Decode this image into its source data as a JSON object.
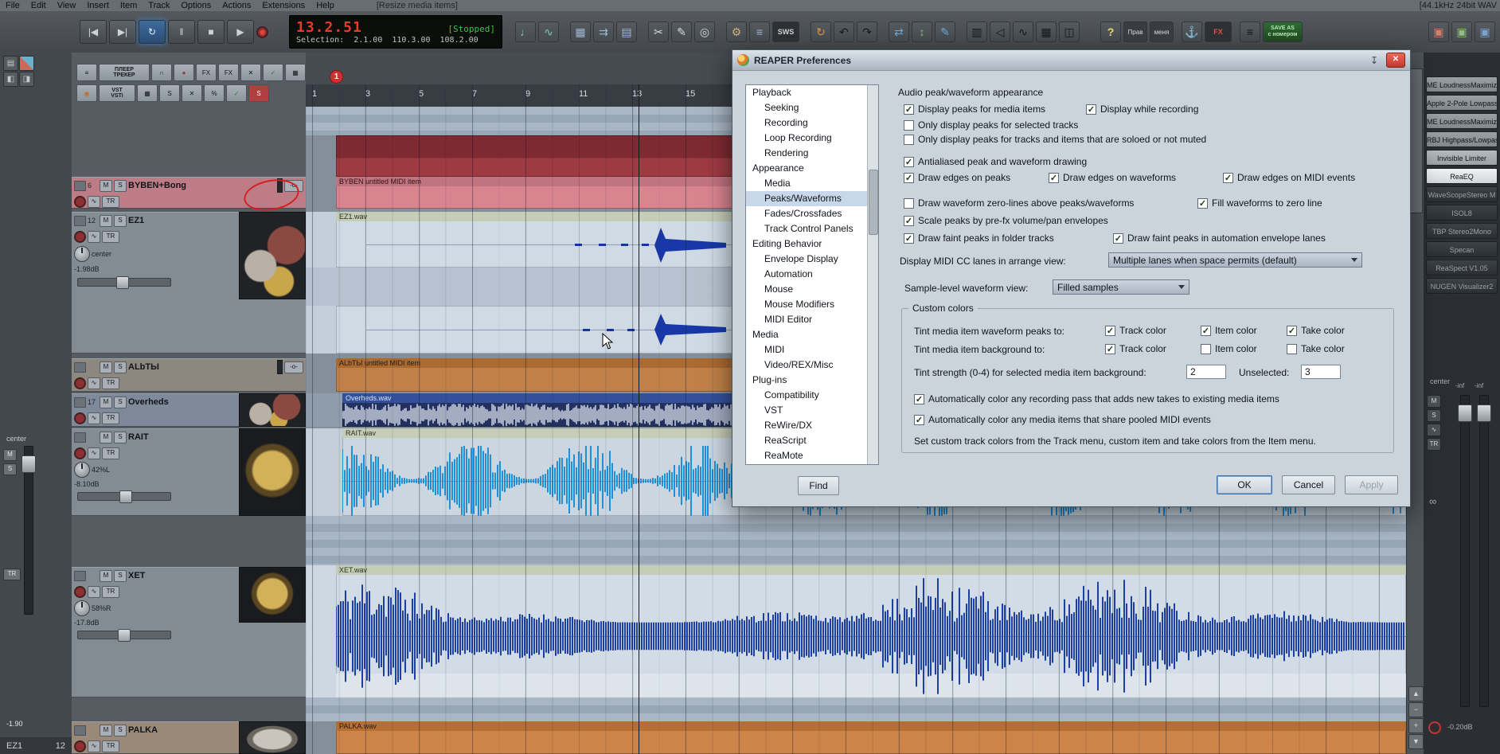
{
  "colors": {
    "time_red": "#e8392b",
    "stopped_green": "#3fc24d",
    "record_red": "#e04438",
    "repeat_active": "#3b82c4",
    "selected_item_navy": "#22315f",
    "wave_blue": "#1d3fa2",
    "rait_blue": "#1f8fd6",
    "byben_pink": "#d8858f",
    "albty_brown": "#bf7a3e",
    "palka_orange": "#cd8448"
  },
  "menu": {
    "items": [
      "File",
      "Edit",
      "View",
      "Insert",
      "Item",
      "Track",
      "Options",
      "Actions",
      "Extensions",
      "Help"
    ],
    "hint": "[Resize media items]",
    "right_status": "[44.1kHz 24bit WAV"
  },
  "transport": {
    "buttons": [
      {
        "name": "go-to-start",
        "g": "|◀"
      },
      {
        "name": "go-to-end",
        "g": "▶|"
      },
      {
        "name": "repeat",
        "g": "↻"
      },
      {
        "name": "pause",
        "g": "‖"
      },
      {
        "name": "stop",
        "g": "■"
      },
      {
        "name": "play",
        "g": "▶"
      },
      {
        "name": "record",
        "g": "●"
      }
    ],
    "time": "13.2.51",
    "state": "[Stopped]",
    "selection_label": "Selection:",
    "sel_start": "2.1.00",
    "sel_end": "110.3.00",
    "sel_length": "108.2.00"
  },
  "toolbar": {
    "icons": [
      {
        "name": "metronome-icon",
        "g": "♩",
        "c": "#7cc8b6"
      },
      {
        "name": "master-env-icon",
        "g": "∿",
        "c": "#7cc8b6"
      },
      {
        "name": "grid-icon",
        "g": "▦",
        "c": "#9db7d2"
      },
      {
        "name": "routing-matrix-icon",
        "g": "⇉",
        "c": "#9db7d2"
      },
      {
        "name": "io-matrix-icon",
        "g": "▤",
        "c": "#9db7d2"
      },
      {
        "name": "scissors-icon",
        "g": "✂",
        "c": "#d6dade"
      },
      {
        "name": "pencil-icon",
        "g": "✎",
        "c": "#d6dade"
      },
      {
        "name": "zoom-icon",
        "g": "◎",
        "c": "#d6dade"
      },
      {
        "name": "wrench-icon",
        "g": "⚙",
        "c": "#cdb27a"
      },
      {
        "name": "mixer-icon",
        "g": "≡",
        "c": "#9db7d2"
      },
      {
        "name": "sws-badge",
        "g": "SWS",
        "c": "#cfd4d8"
      },
      {
        "name": "loop-icon",
        "g": "↻",
        "c": "#e2953f"
      },
      {
        "name": "undo-icon",
        "g": "↶",
        "c": "#c3c8cd"
      },
      {
        "name": "redo-icon",
        "g": "↷",
        "c": "#c3c8cd"
      },
      {
        "name": "sync-icon",
        "g": "⇄",
        "c": "#6fa8dc"
      },
      {
        "name": "nudge-icon",
        "g": "↕",
        "c": "#79c879"
      },
      {
        "name": "draw-icon",
        "g": "✎",
        "c": "#6fa8dc"
      },
      {
        "name": "grid-2-icon",
        "g": "▥",
        "c": "#c3c8cd"
      },
      {
        "name": "speaker-icon",
        "g": "◁",
        "c": "#c3c8cd"
      },
      {
        "name": "envelope-icon",
        "g": "∿",
        "c": "#c3c8cd"
      },
      {
        "name": "table-icon",
        "g": "▦",
        "c": "#c3c8cd"
      },
      {
        "name": "panels-icon",
        "g": "◫",
        "c": "#c3c8cd"
      },
      {
        "name": "help-badge",
        "g": "?",
        "c": "#ead973"
      },
      {
        "name": "prav-button",
        "g": "Прав",
        "c": "#d8dce0"
      },
      {
        "name": "menya-button",
        "g": "меня",
        "c": "#d8dce0"
      },
      {
        "name": "anchor-icon",
        "g": "⚓",
        "c": "#c3c8cd"
      },
      {
        "name": "fx-badge",
        "g": "FX",
        "c": "#e05548"
      },
      {
        "name": "list-icon",
        "g": "≡",
        "c": "#c3c8cd"
      },
      {
        "name": "save-as-badge",
        "g": "SAVE AS\nс номером",
        "c": "#b9e8b2"
      },
      {
        "name": "folder-red-icon",
        "g": "▣",
        "c": "#d77d6a"
      },
      {
        "name": "folder-green-icon",
        "g": "▣",
        "c": "#8fbf7a"
      },
      {
        "name": "folder-blue-icon",
        "g": "▣",
        "c": "#7aa4cf"
      }
    ]
  },
  "mini": {
    "row1": [
      {
        "g": "≡"
      },
      {
        "g": "ПЛЕЕР\nТРЕКЕР"
      },
      {
        "g": "∩"
      },
      {
        "g": "●"
      },
      {
        "g": "FX"
      },
      {
        "g": "FX"
      },
      {
        "g": "✕"
      },
      {
        "g": "✓"
      },
      {
        "g": "▦"
      },
      {
        "g": "↔"
      }
    ],
    "row2": [
      {
        "g": "◉"
      },
      {
        "g": "VST\nVSTi"
      },
      {
        "g": "▦"
      },
      {
        "g": "S"
      },
      {
        "g": "✕"
      },
      {
        "g": "%"
      },
      {
        "g": "✓"
      },
      {
        "g": "S"
      }
    ]
  },
  "ui": {
    "m": "M",
    "s": "S",
    "tr": "TR",
    "io": "-o-",
    "env": "∿",
    "up": "▲",
    "down": "▼",
    "plus": "+",
    "minus": "−",
    "inf": "∞",
    "close": "✕",
    "pin": "↧"
  },
  "tracks": [
    {
      "num": "6",
      "name": "BYBEN+Bong",
      "pan": "",
      "vol": ""
    },
    {
      "num": "12",
      "name": "EZ1",
      "pan": "center",
      "vol": "-1.98dB"
    },
    {
      "num": "",
      "name": "ALbTЫ",
      "pan": "",
      "vol": ""
    },
    {
      "num": "17",
      "name": "Overheds",
      "pan": "",
      "vol": ""
    },
    {
      "num": "",
      "name": "RAIT",
      "pan": "42%L",
      "vol": "-8.10dB"
    },
    {
      "num": "",
      "name": "XET",
      "pan": "58%R",
      "vol": "-17.8dB"
    },
    {
      "num": "",
      "name": "PALKA",
      "pan": "",
      "vol": ""
    }
  ],
  "ruler": {
    "marks": [
      "1",
      "3",
      "5",
      "7",
      "9",
      "11",
      "13",
      "15"
    ],
    "marker1": "1"
  },
  "items": {
    "byben": "BYBEN untitled MIDI item",
    "ez1": "EZ1.wav",
    "albty": "ALbTЫ untitled MIDI item",
    "overheds": "Overheds.wav",
    "rait": "RAIT.wav",
    "xet": "XET.wav",
    "palka": "PALKA.wav"
  },
  "fx_panel": {
    "items": [
      {
        "label": "ME LoudnessMaximizer",
        "variant": "gray"
      },
      {
        "label": "Apple 2-Pole Lowpass",
        "variant": "gray"
      },
      {
        "label": "ME LoudnessMaximizer",
        "variant": "gray"
      },
      {
        "label": "RBJ Highpass/Lowpass",
        "variant": "gray"
      },
      {
        "label": "Invisible Limiter",
        "variant": "light"
      },
      {
        "label": "ReaEQ",
        "variant": "selected"
      },
      {
        "label": "WaveScopeStereo M",
        "variant": "dark"
      },
      {
        "label": "ISOL8",
        "variant": "dark"
      },
      {
        "label": "TBP Stereo2Mono",
        "variant": "dark"
      },
      {
        "label": "Specan",
        "variant": "dark"
      },
      {
        "label": "ReaSpect V1.05",
        "variant": "dark"
      },
      {
        "label": "NUGEN Visualizer2",
        "variant": "dark"
      }
    ]
  },
  "right_mixer": {
    "pan": "center",
    "fader1": "-inf",
    "fader2": "-inf",
    "readout": "-0.20dB"
  },
  "left_strip": {
    "pan": "center",
    "readout": "-1.90",
    "track": "EZ1",
    "num": "12"
  },
  "preferences": {
    "title": "REAPER Preferences",
    "tree": [
      {
        "label": "Playback",
        "indent": 0
      },
      {
        "label": "Seeking",
        "indent": 1
      },
      {
        "label": "Recording",
        "indent": 1
      },
      {
        "label": "Loop Recording",
        "indent": 1
      },
      {
        "label": "Rendering",
        "indent": 1
      },
      {
        "label": "Appearance",
        "indent": 0
      },
      {
        "label": "Media",
        "indent": 1
      },
      {
        "label": "Peaks/Waveforms",
        "indent": 1
      },
      {
        "label": "Fades/Crossfades",
        "indent": 1
      },
      {
        "label": "Track Control Panels",
        "indent": 1
      },
      {
        "label": "Editing Behavior",
        "indent": 0
      },
      {
        "label": "Envelope Display",
        "indent": 1
      },
      {
        "label": "Automation",
        "indent": 1
      },
      {
        "label": "Mouse",
        "indent": 1
      },
      {
        "label": "Mouse Modifiers",
        "indent": 1
      },
      {
        "label": "MIDI Editor",
        "indent": 1
      },
      {
        "label": "Media",
        "indent": 0
      },
      {
        "label": "MIDI",
        "indent": 1
      },
      {
        "label": "Video/REX/Misc",
        "indent": 1
      },
      {
        "label": "Plug-ins",
        "indent": 0
      },
      {
        "label": "Compatibility",
        "indent": 1
      },
      {
        "label": "VST",
        "indent": 1
      },
      {
        "label": "ReWire/DX",
        "indent": 1
      },
      {
        "label": "ReaScript",
        "indent": 1
      },
      {
        "label": "ReaMote",
        "indent": 1
      }
    ],
    "find_label": "Find",
    "section_title": "Audio peak/waveform appearance",
    "labels": {
      "display_peaks": "Display peaks for media items",
      "display_recording": "Display while recording",
      "only_selected": "Only display peaks for selected tracks",
      "only_soloed": "Only display peaks for tracks and items that are soloed or not muted",
      "antialiased": "Antialiased peak and waveform drawing",
      "edges_peaks": "Draw edges on peaks",
      "edges_waveforms": "Draw edges on waveforms",
      "edges_midi": "Draw edges on MIDI events",
      "zero_lines": "Draw waveform zero-lines above peaks/waveforms",
      "fill_zero": "Fill waveforms to zero line",
      "scale_prefx": "Scale peaks by pre-fx volume/pan envelopes",
      "faint_folder": "Draw faint peaks in folder tracks",
      "faint_env": "Draw faint peaks in automation envelope lanes",
      "midi_cc": "Display MIDI CC lanes in arrange view:",
      "midi_cc_value": "Multiple lanes when space permits (default)",
      "sample_view": "Sample-level waveform view:",
      "sample_view_value": "Filled samples",
      "custom_colors": "Custom colors",
      "tint_peaks": "Tint media item waveform peaks to:",
      "tint_bg": "Tint media item background to:",
      "track_color": "Track color",
      "item_color": "Item color",
      "take_color": "Take color",
      "tint_strength": "Tint strength (0-4) for selected media item background:",
      "unselected": "Unselected:",
      "auto_rec": "Automatically color any recording pass that adds new takes to existing media items",
      "auto_pooled": "Automatically color any media items that share pooled MIDI events",
      "note": "Set custom track colors from the Track menu, custom item and take colors from the Item menu."
    },
    "checks": {
      "display_peaks": true,
      "display_recording": true,
      "only_selected": false,
      "only_soloed": false,
      "antialiased": true,
      "edges_peaks": true,
      "edges_waveforms": true,
      "edges_midi": true,
      "zero_lines": false,
      "fill_zero": true,
      "scale_prefx": true,
      "faint_folder": true,
      "faint_env": true,
      "tint_peaks_track": true,
      "tint_peaks_item": true,
      "tint_peaks_take": true,
      "tint_bg_track": true,
      "tint_bg_item": false,
      "tint_bg_take": false,
      "auto_rec": true,
      "auto_pooled": true
    },
    "values": {
      "strength_selected": "2",
      "strength_unselected": "3"
    },
    "buttons": {
      "ok": "OK",
      "cancel": "Cancel",
      "apply": "Apply"
    }
  }
}
